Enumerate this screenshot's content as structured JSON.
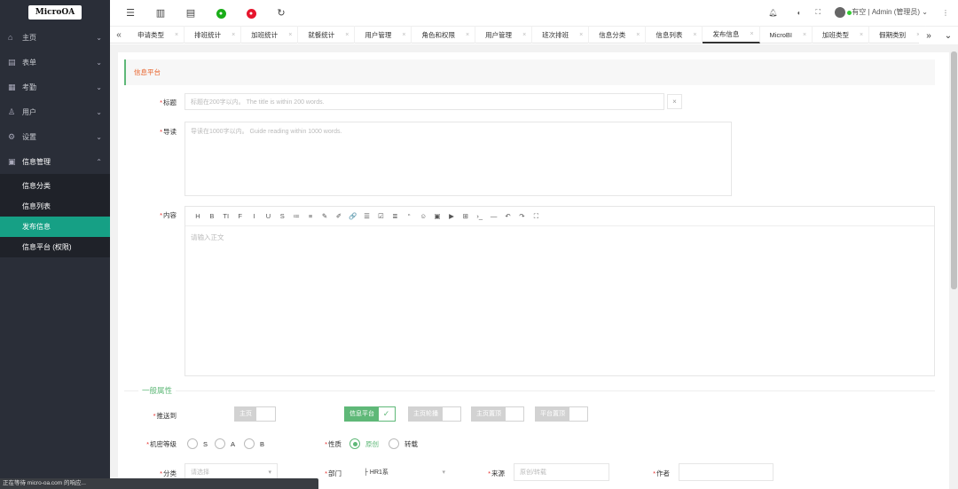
{
  "brand": {
    "logo": "MicroOA"
  },
  "sidebar": {
    "items": [
      {
        "label": "主页",
        "icon": "home-icon"
      },
      {
        "label": "表单",
        "icon": "form-icon"
      },
      {
        "label": "考勤",
        "icon": "attendance-icon"
      },
      {
        "label": "用户",
        "icon": "user-icon"
      },
      {
        "label": "设置",
        "icon": "gear-icon"
      },
      {
        "label": "信息管理",
        "icon": "document-icon"
      }
    ],
    "sub_items": [
      {
        "label": "信息分类"
      },
      {
        "label": "信息列表"
      },
      {
        "label": "发布信息"
      },
      {
        "label": "信息平台 (权限)"
      }
    ]
  },
  "topbar": {
    "user_status": "有空",
    "user_name": "Admin (管理员)"
  },
  "tabs": [
    {
      "label": "申请类型"
    },
    {
      "label": "排班统计"
    },
    {
      "label": "加班统计"
    },
    {
      "label": "就餐统计"
    },
    {
      "label": "用户管理"
    },
    {
      "label": "角色和权限"
    },
    {
      "label": "用户管理"
    },
    {
      "label": "班次排班"
    },
    {
      "label": "信息分类"
    },
    {
      "label": "信息列表"
    },
    {
      "label": "发布信息"
    },
    {
      "label": "MicroBI"
    },
    {
      "label": "加班类型"
    },
    {
      "label": "假期类别"
    }
  ],
  "form": {
    "section_title": "信息平台",
    "title_label": "标题",
    "title_placeholder": "标题在200字以内。 The title is within 200 words.",
    "guide_label": "导读",
    "guide_placeholder": "导读在1000字以内。 Guide reading within 1000 words.",
    "content_label": "内容",
    "content_placeholder": "请输入正文",
    "toolbar": [
      "H",
      "B",
      "TI",
      "F",
      "I",
      "U",
      "S",
      "≔",
      "≡",
      "✎",
      "✐",
      "🔗",
      "☰",
      "☑",
      "≣",
      "“",
      "☺",
      "▣",
      "▶",
      "⊞",
      "›_",
      "—",
      "↶",
      "↷",
      "⛶"
    ],
    "general_legend": "一般属性",
    "push_label": "推送到",
    "push_switches": [
      {
        "label": "主页",
        "on": false
      },
      {
        "label": "信息平台",
        "on": true
      },
      {
        "label": "主页轮播",
        "on": false
      },
      {
        "label": "主页置顶",
        "on": false
      },
      {
        "label": "平台置顶",
        "on": false
      }
    ],
    "secret_label": "机密等级",
    "secret_options": [
      "S",
      "A",
      "B"
    ],
    "nature_label": "性质",
    "nature_options": [
      {
        "label": "原创",
        "on": true
      },
      {
        "label": "转载",
        "on": false
      }
    ],
    "category_label": "分类",
    "category_placeholder": "请选择",
    "dept_label": "部门",
    "dept_value": "├ HR1系",
    "source_label": "来源",
    "source_placeholder": "原创/转载",
    "author_label": "作者"
  },
  "status_bar": "正在等待 micro-oa.com 的响应..."
}
